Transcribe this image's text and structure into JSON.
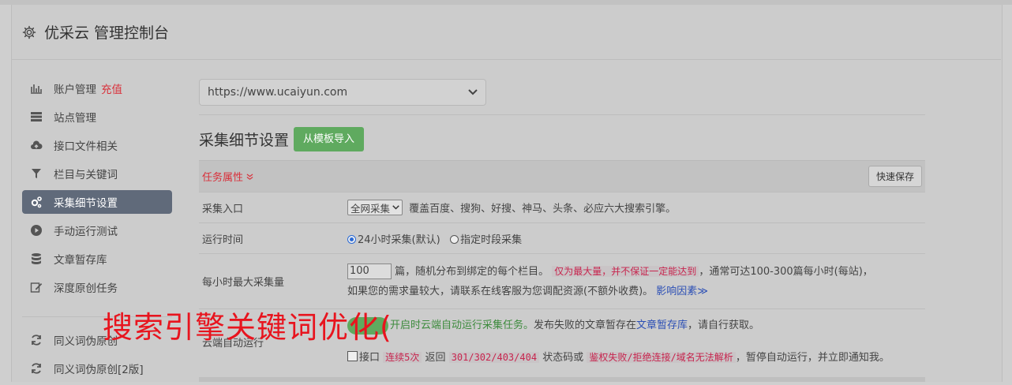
{
  "header": {
    "title": "优采云 管理控制台"
  },
  "sidebar": {
    "items": [
      {
        "label": "账户管理",
        "extra": "充值",
        "icon": "bar-chart-icon"
      },
      {
        "label": "站点管理",
        "icon": "server-icon"
      },
      {
        "label": "接口文件相关",
        "icon": "cloud-upload-icon"
      },
      {
        "label": "栏目与关键词",
        "icon": "filter-icon"
      },
      {
        "label": "采集细节设置",
        "icon": "gears-icon",
        "active": true
      },
      {
        "label": "手动运行测试",
        "icon": "play-icon"
      },
      {
        "label": "文章暂存库",
        "icon": "database-icon"
      },
      {
        "label": "深度原创任务",
        "icon": "edit-icon"
      },
      {
        "label": "同义词伪原创",
        "icon": "refresh-icon"
      },
      {
        "label": "同义词伪原创[2版]",
        "icon": "refresh-icon"
      }
    ]
  },
  "main": {
    "url_select": "https://www.ucaiyun.com",
    "section_title": "采集细节设置",
    "import_button": "从模板导入",
    "task_attr_label": "任务属性",
    "quick_save": "快速保存",
    "rows": {
      "entry": {
        "label": "采集入口",
        "select": "全网采集",
        "text": "覆盖百度、搜狗、好搜、神马、头条、必应六大搜索引擎。"
      },
      "time": {
        "label": "运行时间",
        "opt1": "24小时采集(默认)",
        "opt2": "指定时段采集"
      },
      "max": {
        "label": "每小时最大采集量",
        "input": "100",
        "t1": "篇，随机分布到绑定的每个栏目。",
        "code": "仅为最大量，并不保证一定能达到",
        "t2": "，通常可达100-300篇每小时(每站)，",
        "t3": "如果您的需求量较大，请联系在线客服为您调配资源(不额外收费)。",
        "link": "影响因素"
      },
      "cloud": {
        "label": "云端自动运行",
        "green": "开启时云端自动运行采集任务。",
        "t1": "发布失败的文章暂存在",
        "link": "文章暂存库",
        "t2": "，请自行获取。",
        "c_label": "接口",
        "code1": "连续5次",
        "t3": "返回",
        "code2": "301/302/403/404",
        "t4": "状态码或",
        "code3": "鉴权失败/拒绝连接/域名无法解析",
        "t5": "，暂停自动运行，并立即通知我。"
      }
    }
  },
  "overlay": {
    "text": "搜索引擎关键词优化("
  }
}
